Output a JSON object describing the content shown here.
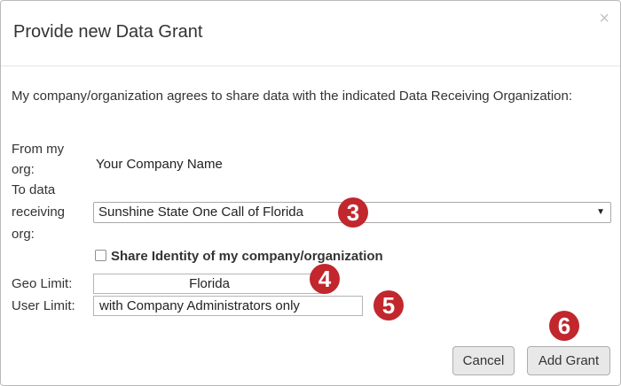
{
  "dialog": {
    "title": "Provide new Data Grant",
    "close_glyph": "×"
  },
  "intro_text": "My company/organization agrees to share data with the indicated Data Receiving Organization:",
  "from_org": {
    "label_line1": "From my",
    "label_line2": "org:",
    "value": "Your Company Name"
  },
  "to_org": {
    "label_line1": "To data",
    "label_line2": "receiving",
    "label_line3": "org:",
    "selected": "Sunshine State One Call of Florida",
    "caret": "▼"
  },
  "share_identity": {
    "label": "Share Identity of my company/organization",
    "checked": false
  },
  "geo_limit": {
    "label": "Geo Limit:",
    "value": "Florida"
  },
  "user_limit": {
    "label": "User Limit:",
    "value": "with Company Administrators only"
  },
  "badges": {
    "three": "3",
    "four": "4",
    "five": "5",
    "six": "6"
  },
  "buttons": {
    "cancel": "Cancel",
    "add_grant": "Add Grant"
  },
  "colors": {
    "badge": "#c1272d",
    "button_bg": "#e8e8e8"
  }
}
